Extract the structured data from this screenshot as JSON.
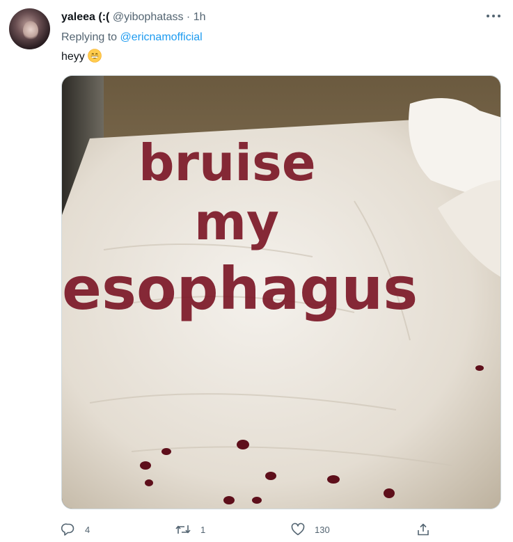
{
  "tweet": {
    "display_name": "yaleea (:(",
    "handle": "@yibophatass",
    "separator": "·",
    "time": "1h",
    "replying_prefix": "Replying to",
    "replying_to": "@ericnamofficial",
    "text": "heyy",
    "emoji": "grinning-face-emoji"
  },
  "media": {
    "overlay_text_lines": [
      "bruise",
      "my",
      "esophagus"
    ]
  },
  "actions": {
    "reply_count": "4",
    "retweet_count": "1",
    "like_count": "130"
  },
  "colors": {
    "accent": "#1d9bf0",
    "secondary_text": "#536471",
    "primary_text": "#0f1419",
    "petals": "#7a1424"
  }
}
